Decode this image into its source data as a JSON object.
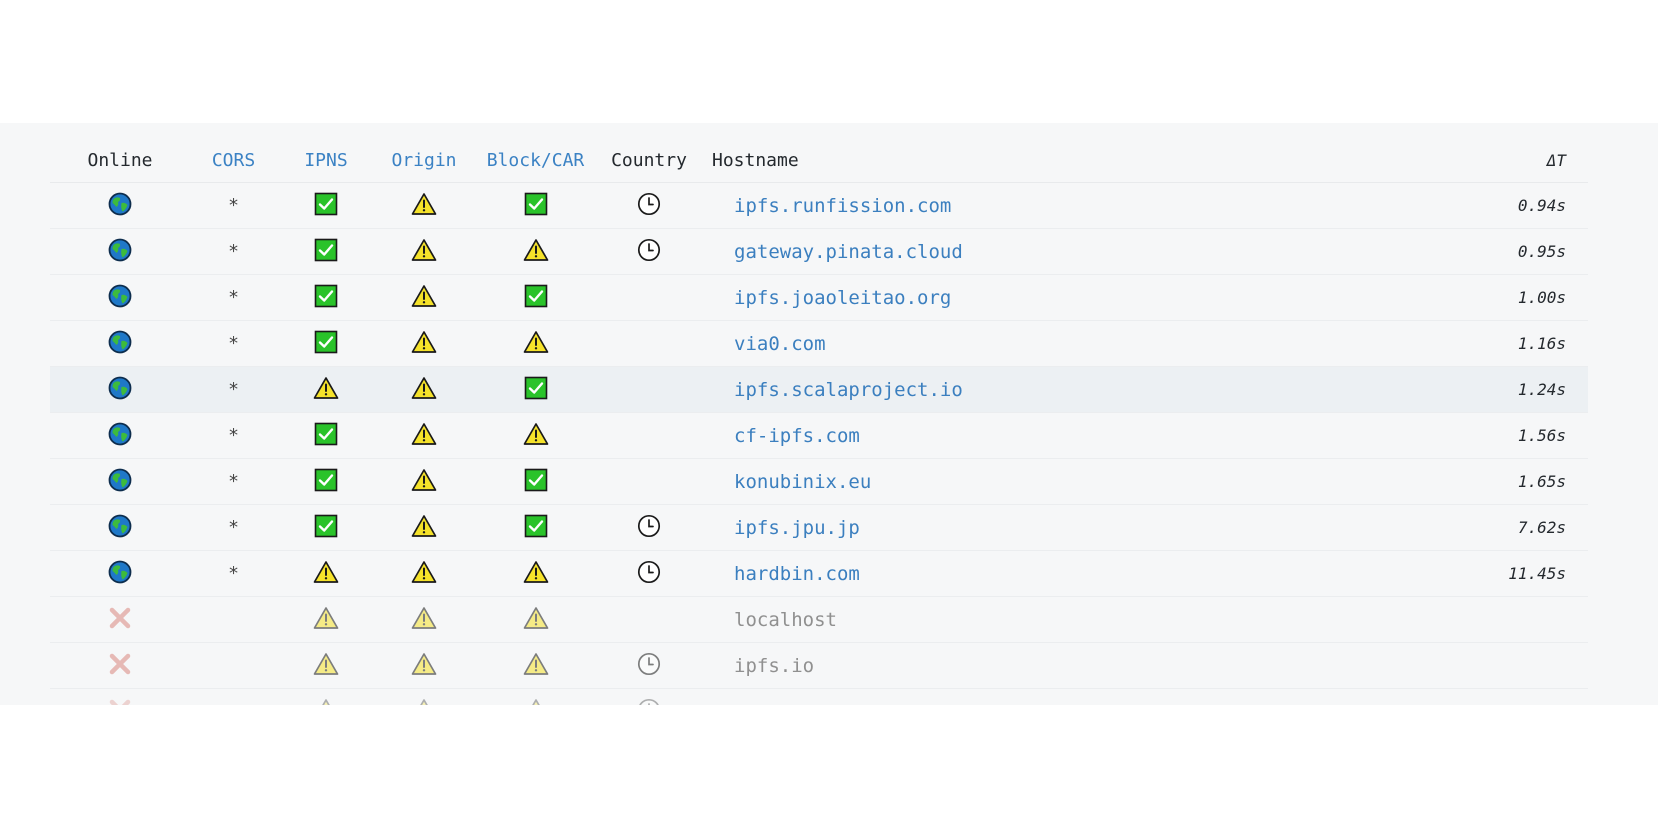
{
  "headers": {
    "online": "Online",
    "cors": "CORS",
    "ipns": "IPNS",
    "origin": "Origin",
    "block_car": "Block/CAR",
    "country": "Country",
    "hostname": "Hostname",
    "delta": "ΔT"
  },
  "icons": {
    "online": "globe-icon",
    "offline": "cross-icon",
    "ok": "check-icon",
    "warn": "warning-icon",
    "pending": "clock-icon"
  },
  "colors": {
    "link": "#3b82c4",
    "check_green": "#2ac32a",
    "warning_yellow": "#f5e22a",
    "offline_red": "#d9887f"
  },
  "rows": [
    {
      "online": "online",
      "cors": "*",
      "ipns": "ok",
      "origin": "warn",
      "block_car": "ok",
      "country": "pending",
      "hostname": "ipfs.runfission.com",
      "delta": "0.94s"
    },
    {
      "online": "online",
      "cors": "*",
      "ipns": "ok",
      "origin": "warn",
      "block_car": "warn",
      "country": "pending",
      "hostname": "gateway.pinata.cloud",
      "delta": "0.95s"
    },
    {
      "online": "online",
      "cors": "*",
      "ipns": "ok",
      "origin": "warn",
      "block_car": "ok",
      "country": "",
      "hostname": "ipfs.joaoleitao.org",
      "delta": "1.00s"
    },
    {
      "online": "online",
      "cors": "*",
      "ipns": "ok",
      "origin": "warn",
      "block_car": "warn",
      "country": "",
      "hostname": "via0.com",
      "delta": "1.16s"
    },
    {
      "online": "online",
      "cors": "*",
      "ipns": "warn",
      "origin": "warn",
      "block_car": "ok",
      "country": "",
      "hostname": "ipfs.scalaproject.io",
      "delta": "1.24s",
      "highlight": true
    },
    {
      "online": "online",
      "cors": "*",
      "ipns": "ok",
      "origin": "warn",
      "block_car": "warn",
      "country": "",
      "hostname": "cf-ipfs.com",
      "delta": "1.56s"
    },
    {
      "online": "online",
      "cors": "*",
      "ipns": "ok",
      "origin": "warn",
      "block_car": "ok",
      "country": "",
      "hostname": "konubinix.eu",
      "delta": "1.65s"
    },
    {
      "online": "online",
      "cors": "*",
      "ipns": "ok",
      "origin": "warn",
      "block_car": "ok",
      "country": "pending",
      "hostname": "ipfs.jpu.jp",
      "delta": "7.62s"
    },
    {
      "online": "online",
      "cors": "*",
      "ipns": "warn",
      "origin": "warn",
      "block_car": "warn",
      "country": "pending",
      "hostname": "hardbin.com",
      "delta": "11.45s"
    },
    {
      "online": "offline",
      "cors": "",
      "ipns": "warn",
      "origin": "warn",
      "block_car": "warn",
      "country": "",
      "hostname": "localhost",
      "delta": ""
    },
    {
      "online": "offline",
      "cors": "",
      "ipns": "warn",
      "origin": "warn",
      "block_car": "warn",
      "country": "pending",
      "hostname": "ipfs.io",
      "delta": ""
    },
    {
      "online": "offline",
      "cors": "",
      "ipns": "warn",
      "origin": "warn",
      "block_car": "warn",
      "country": "pending",
      "hostname": "",
      "delta": ""
    }
  ]
}
